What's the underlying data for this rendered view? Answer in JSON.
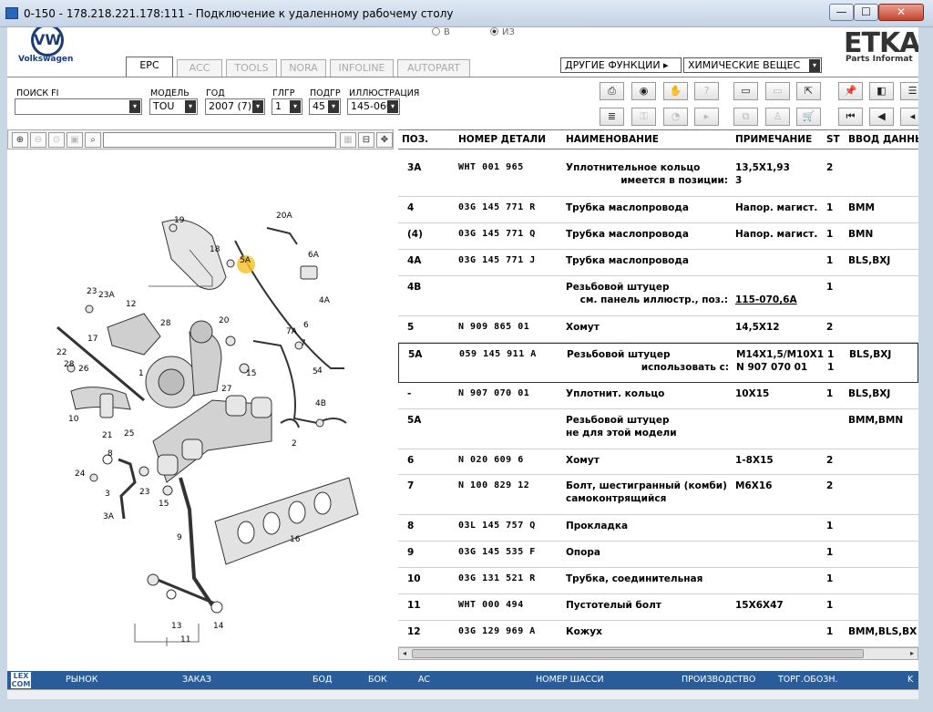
{
  "window": {
    "title": "0-150 - 178.218.221.178:111 - Подключение к удаленному рабочему столу",
    "min_glyph": "—",
    "max_glyph": "☐",
    "close_glyph": "✕"
  },
  "header": {
    "brand_logo": "VW",
    "brand_name": "Volkswagen",
    "radio_v": "В",
    "radio_iz": "ИЗ",
    "etka_logo": "ETKA",
    "etka_sub": "Parts Informat"
  },
  "tabs": [
    "EPC",
    "ACC",
    "TOOLS",
    "NORA",
    "INFOLINE",
    "AUTOPART"
  ],
  "functions": {
    "other_label": "ДРУГИЕ ФУНКЦИИ ▸",
    "chem_label": "ХИМИЧЕСКИЕ ВЕЩЕС"
  },
  "search": {
    "labels": {
      "fi": "ПОИСК FI",
      "model": "МОДЕЛЬ",
      "year": "ГОД",
      "hg": "ГЛГР",
      "ug": "ПОДГР",
      "illu": "ИЛЛЮСТРАЦИЯ"
    },
    "values": {
      "fi": "",
      "model": "TOU",
      "year": "2007 (7)",
      "hg": "1",
      "ug": "45",
      "illu": "145-060"
    }
  },
  "icons": {
    "dropdown": "▾",
    "zoom_in": "⊕",
    "zoom_out": "⊖",
    "search": "⌕",
    "hscroll_left": "◂",
    "hscroll_right": "▸"
  },
  "table": {
    "headers": {
      "pos": "ПОЗ.",
      "part": "НОМЕР ДЕТАЛИ",
      "name": "НАИМЕНОВАНИЕ",
      "note": "ПРИМЕЧАНИЕ",
      "st": "ST",
      "input": "ВВОД ДАННЫ"
    },
    "rows": [
      {
        "pos": "3A",
        "part": "WHT 001 965",
        "name": "Уплотнительное кольцо",
        "note": "13,5X1,93",
        "st": "2",
        "input": "",
        "sub_name": "имеется в позиции:",
        "sub_note": "3"
      },
      {
        "pos": "4",
        "part": "03G 145 771 R",
        "name": "Трубка маслопровода",
        "note": "Напор. магист.",
        "st": "1",
        "input": "BMM"
      },
      {
        "pos": "(4)",
        "part": "03G 145 771 Q",
        "name": "Трубка маслопровода",
        "note": "Напор. магист.",
        "st": "1",
        "input": "BMN"
      },
      {
        "pos": "4A",
        "part": "03G 145 771 J",
        "name": "Трубка маслопровода",
        "note": "",
        "st": "1",
        "input": "BLS,BXJ"
      },
      {
        "pos": "4B",
        "part": "",
        "name": "Резьбовой штуцер",
        "note": "",
        "st": "1",
        "input": "",
        "sub_name": "см. панель иллюстр., поз.:",
        "sub_note": "115-070,6A"
      },
      {
        "pos": "5",
        "part": "N   909 865 01",
        "name": "Хомут",
        "note": "14,5X12",
        "st": "2",
        "input": ""
      },
      {
        "pos": "5A",
        "part": "059 145 911 A",
        "name": "Резьбовой штуцер",
        "note": "M14X1,5/M10X1",
        "st": "1",
        "input": "BLS,BXJ",
        "sub_name": "использовать с:",
        "sub_note": "N   907 070 01",
        "sub_st": "1"
      },
      {
        "pos": "-",
        "part": "N   907 070 01",
        "name": "Уплотнит. кольцо",
        "note": "10X15",
        "st": "1",
        "input": "BLS,BXJ"
      },
      {
        "pos": "5A",
        "part": "",
        "name": "Резьбовой штуцер",
        "note": "",
        "st": "",
        "input": "BMM,BMN",
        "sub_name": "не для этой модели"
      },
      {
        "pos": "6",
        "part": "N   020 609 6",
        "name": "Хомут",
        "note": "1-8X15",
        "st": "2",
        "input": ""
      },
      {
        "pos": "7",
        "part": "N   100 829 12",
        "name": "Болт, шестигранный (комби)",
        "note": "M6X16",
        "st": "2",
        "input": "",
        "sub_name": "самоконтрящийся"
      },
      {
        "pos": "8",
        "part": "03L 145 757 Q",
        "name": "Прокладка",
        "note": "",
        "st": "1",
        "input": ""
      },
      {
        "pos": "9",
        "part": "03G 145 535 F",
        "name": "Опора",
        "note": "",
        "st": "1",
        "input": ""
      },
      {
        "pos": "10",
        "part": "03G 131 521 R",
        "name": "Трубка, соединительная",
        "note": "",
        "st": "1",
        "input": ""
      },
      {
        "pos": "11",
        "part": "WHT 000 494",
        "name": "Пустотелый болт",
        "note": "15X6X47",
        "st": "1",
        "input": ""
      },
      {
        "pos": "12",
        "part": "03G 129 969 A",
        "name": "Кожух",
        "note": "",
        "st": "1",
        "input": "BMM,BLS,BX"
      }
    ]
  },
  "diagram": {
    "callouts": [
      "19",
      "20A",
      "18",
      "5A",
      "6A",
      "23",
      "23A",
      "12",
      "20",
      "28",
      "4A",
      "7A",
      "6",
      "7",
      "17",
      "5",
      "22",
      "28",
      "26",
      "1",
      "15",
      "4",
      "27",
      "10",
      "21",
      "25",
      "8",
      "24",
      "23",
      "3",
      "15",
      "4B",
      "2",
      "3A",
      "9",
      "16",
      "13",
      "14",
      "11"
    ]
  },
  "statusbar": {
    "lex_logo": "LEX",
    "lex_sub": "COM",
    "market": "РЫНОК",
    "order": "ЗАКАЗ",
    "bod": "БОД",
    "bok": "БОК",
    "ac": "AC",
    "chassis": "НОМЕР ШАССИ",
    "production": "ПРОИЗВОДСТВО",
    "tradename": "ТОРГ.ОБОЗН.",
    "kcol": "K"
  },
  "colors": {
    "accent": "#2a5c9a",
    "highlight": "#f4c430",
    "selected_row_border": "#333333"
  }
}
